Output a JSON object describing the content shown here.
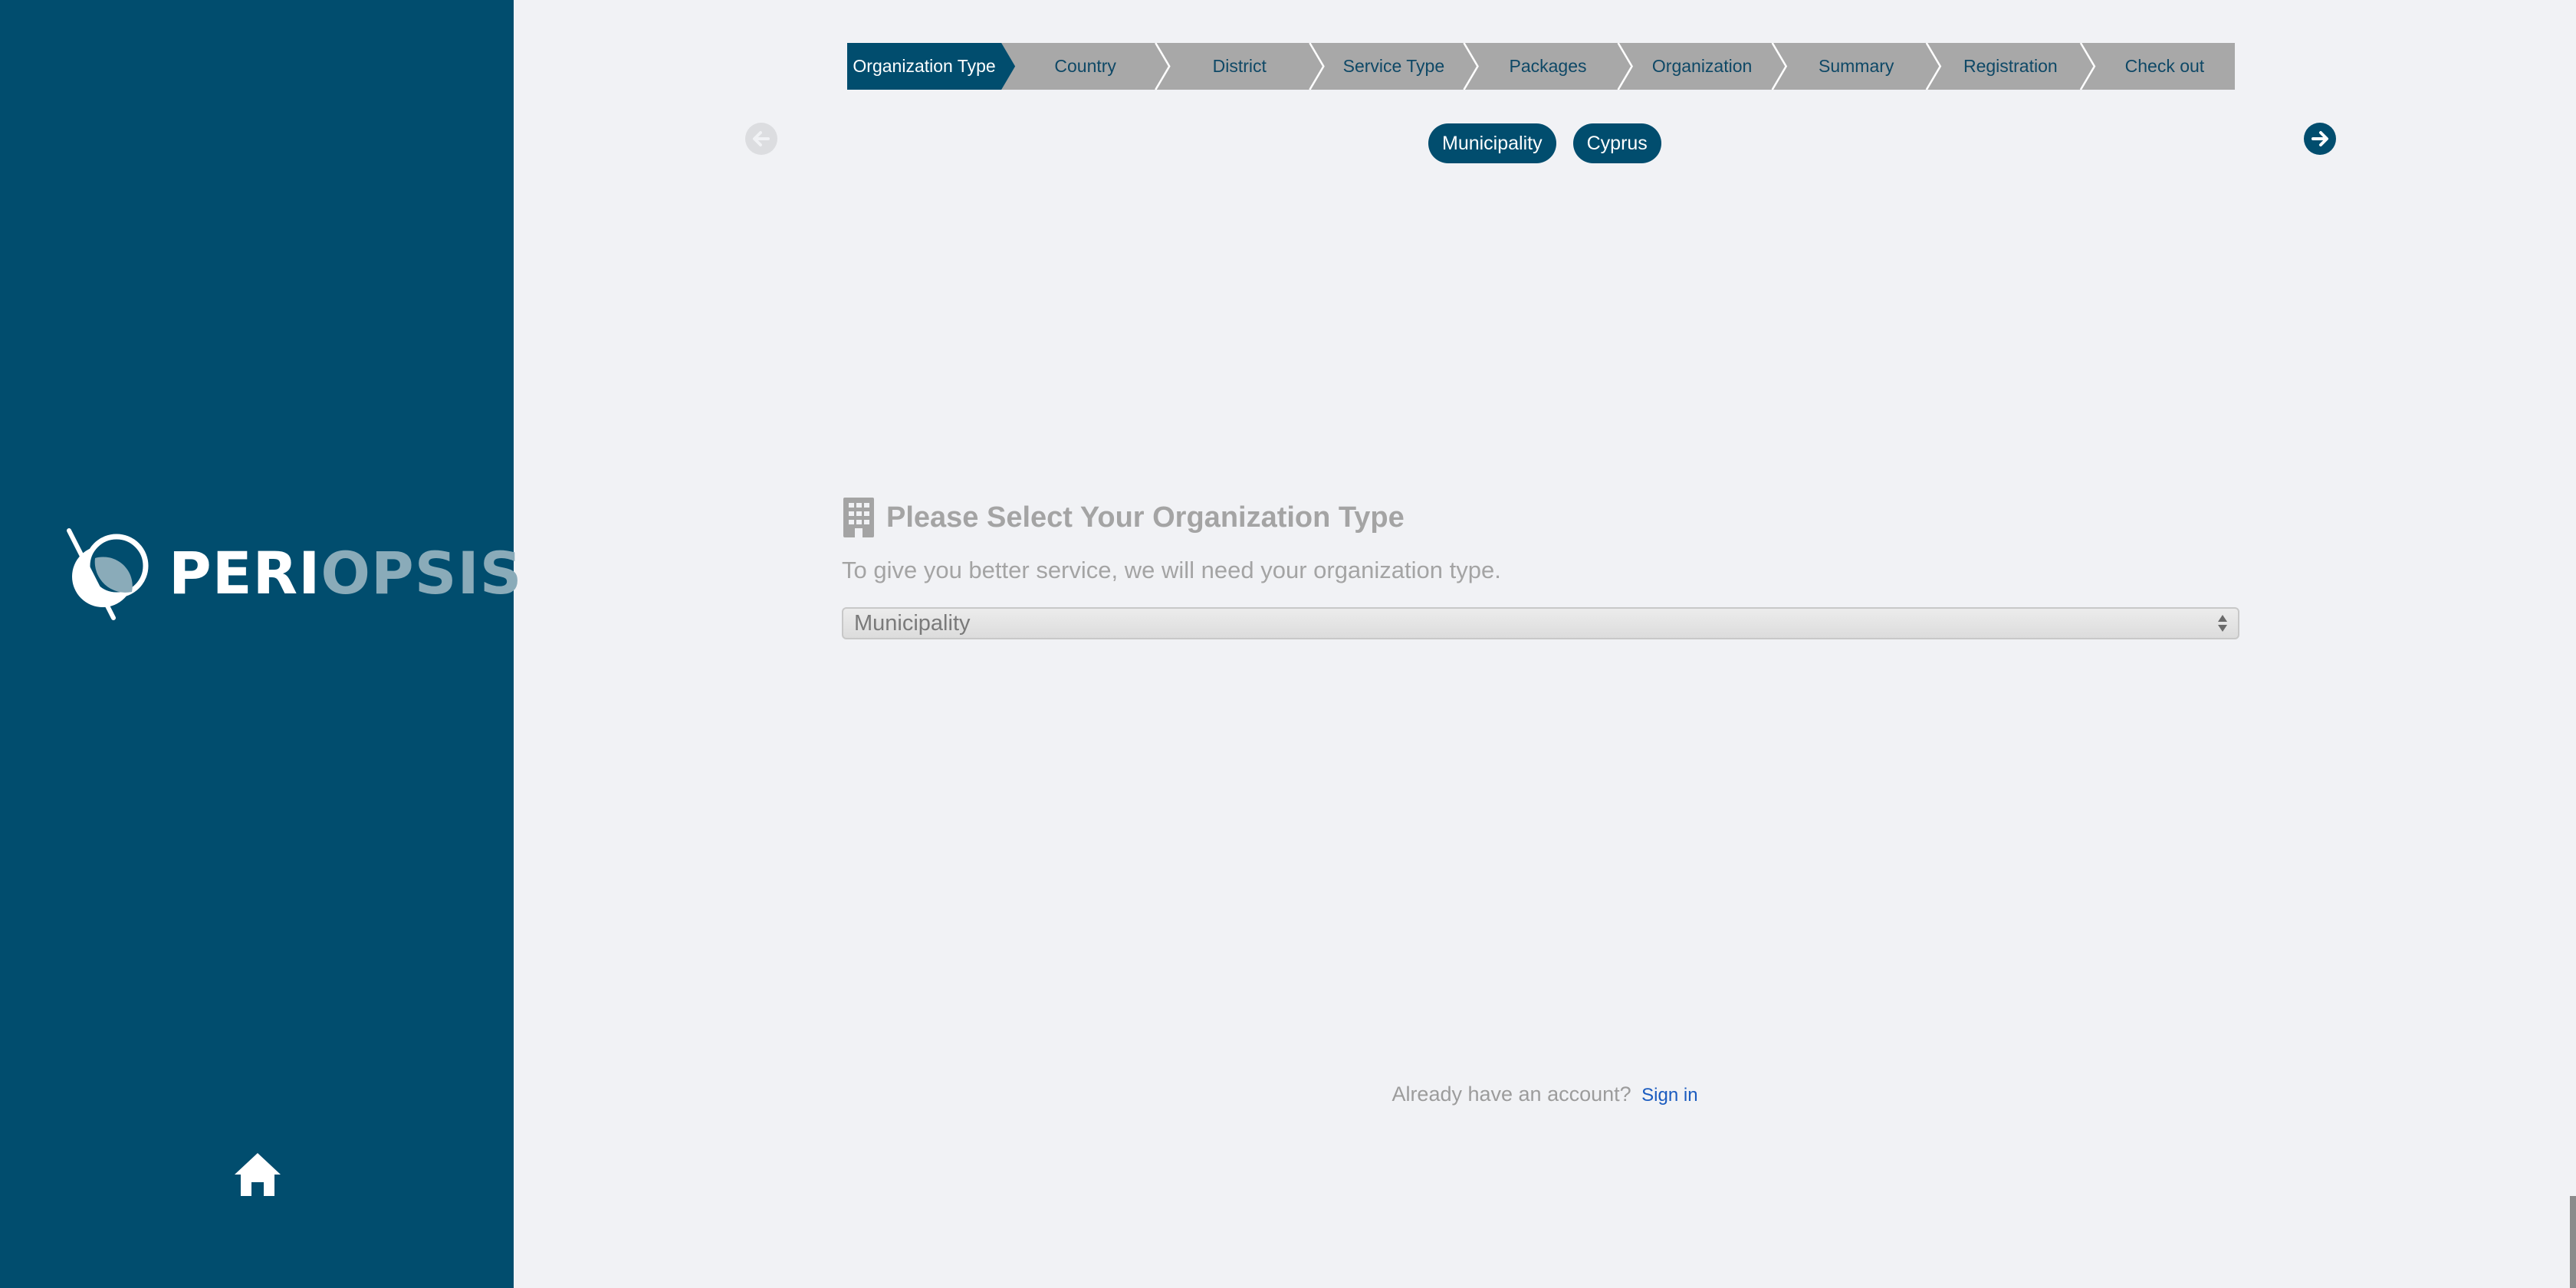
{
  "brand": {
    "name_part1": "PERI",
    "name_part2": "OPSIS",
    "color_primary": "#014d6e",
    "color_secondary": "#8aabb9"
  },
  "sidebar": {
    "home_icon": "home-icon"
  },
  "stepper": {
    "active_index": 0,
    "active_color": "#014d6e",
    "inactive_color": "#a8a8a8",
    "steps": [
      {
        "label": "Organization Type"
      },
      {
        "label": "Country"
      },
      {
        "label": "District"
      },
      {
        "label": "Service Type"
      },
      {
        "label": "Packages"
      },
      {
        "label": "Organization"
      },
      {
        "label": "Summary"
      },
      {
        "label": "Registration"
      },
      {
        "label": "Check out"
      }
    ]
  },
  "navigation": {
    "prev_icon": "arrow-left-icon",
    "next_icon": "arrow-right-icon"
  },
  "selection_chips": [
    {
      "label": "Municipality"
    },
    {
      "label": "Cyprus"
    }
  ],
  "form": {
    "icon": "building-icon",
    "title": "Please Select Your Organization Type",
    "description": "To give you better service, we will need your organization type.",
    "select_value": "Municipality"
  },
  "footer": {
    "prompt": "Already have an account?",
    "signin_label": "Sign in"
  }
}
